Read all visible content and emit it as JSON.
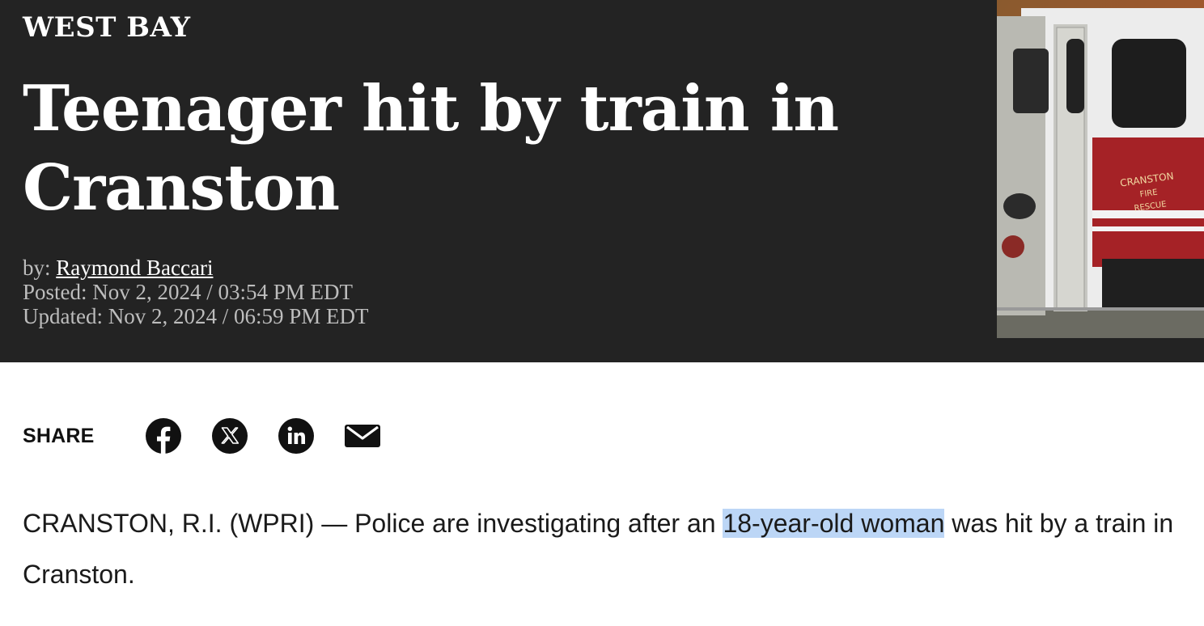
{
  "article": {
    "section": "WEST BAY",
    "headline": "Teenager hit by train in Cranston",
    "byline_prefix": "by: ",
    "author": "Raymond Baccari",
    "posted": "Posted: Nov 2, 2024 / 03:54 PM EDT",
    "updated": "Updated: Nov 2, 2024 / 06:59 PM EDT",
    "photo_truck_text": {
      "line1": "CRANSTON",
      "line2": "FIRE",
      "line3": "RESCUE"
    }
  },
  "share": {
    "label": "SHARE",
    "buttons": [
      {
        "name": "facebook",
        "icon": "facebook-icon"
      },
      {
        "name": "x",
        "icon": "x-icon"
      },
      {
        "name": "linkedin",
        "icon": "linkedin-icon"
      },
      {
        "name": "email",
        "icon": "mail-icon"
      }
    ]
  },
  "body": {
    "p1_before": "CRANSTON, R.I. (WPRI) — Police are investigating after an ",
    "p1_highlight": "18-year-old woman",
    "p1_after": " was hit by a train in Cranston."
  },
  "colors": {
    "hero_bg": "#232323",
    "highlight": "#bcd6f6"
  }
}
